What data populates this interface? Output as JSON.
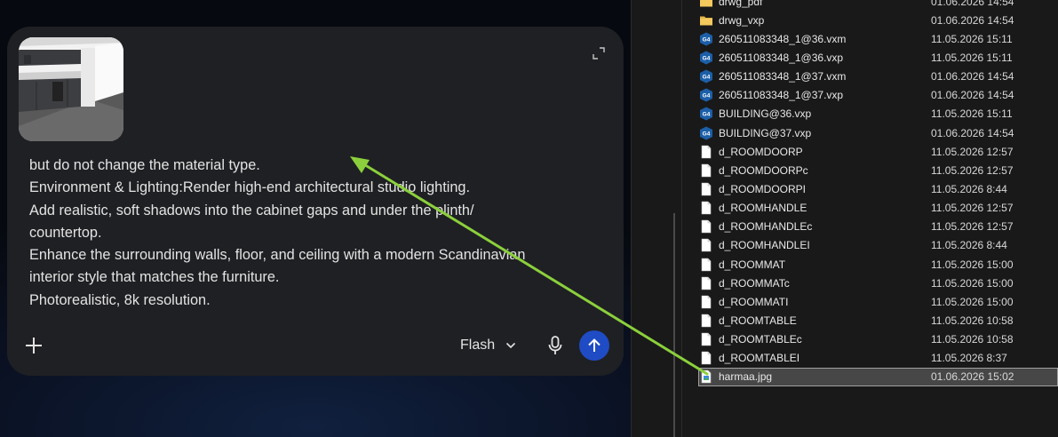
{
  "chat": {
    "prompt_lines": [
      "but do not change the material type.",
      "Environment & Lighting:Render high-end architectural studio lighting.",
      "Add realistic, soft shadows into the cabinet gaps and under the plinth/",
      "countertop.",
      "Enhance the surrounding walls, floor, and ceiling with a modern Scandinavian",
      "interior style that matches the furniture.",
      "Photorealistic, 8k resolution."
    ],
    "model_label": "Flash",
    "accent_color": "#1f4bc4"
  },
  "explorer": {
    "files": [
      {
        "name": "drwg_pdf",
        "date": "01.06.2026 14:54",
        "icon": "folder-icon"
      },
      {
        "name": "drwg_vxp",
        "date": "01.06.2026 14:54",
        "icon": "folder-icon"
      },
      {
        "name": "260511083348_1@36.vxm",
        "date": "11.05.2026 15:11",
        "icon": "g4-app-icon"
      },
      {
        "name": "260511083348_1@36.vxp",
        "date": "11.05.2026 15:11",
        "icon": "g4-app-icon"
      },
      {
        "name": "260511083348_1@37.vxm",
        "date": "01.06.2026 14:54",
        "icon": "g4-app-icon"
      },
      {
        "name": "260511083348_1@37.vxp",
        "date": "01.06.2026 14:54",
        "icon": "g4-app-icon"
      },
      {
        "name": "BUILDING@36.vxp",
        "date": "11.05.2026 15:11",
        "icon": "g4-app-icon"
      },
      {
        "name": "BUILDING@37.vxp",
        "date": "01.06.2026 14:54",
        "icon": "g4-app-icon"
      },
      {
        "name": "d_ROOMDOORP",
        "date": "11.05.2026 12:57",
        "icon": "file-icon"
      },
      {
        "name": "d_ROOMDOORPc",
        "date": "11.05.2026 12:57",
        "icon": "file-icon"
      },
      {
        "name": "d_ROOMDOORPI",
        "date": "11.05.2026 8:44",
        "icon": "file-icon"
      },
      {
        "name": "d_ROOMHANDLE",
        "date": "11.05.2026 12:57",
        "icon": "file-icon"
      },
      {
        "name": "d_ROOMHANDLEc",
        "date": "11.05.2026 12:57",
        "icon": "file-icon"
      },
      {
        "name": "d_ROOMHANDLEI",
        "date": "11.05.2026 8:44",
        "icon": "file-icon"
      },
      {
        "name": "d_ROOMMAT",
        "date": "11.05.2026 15:00",
        "icon": "file-icon"
      },
      {
        "name": "d_ROOMMATc",
        "date": "11.05.2026 15:00",
        "icon": "file-icon"
      },
      {
        "name": "d_ROOMMATI",
        "date": "11.05.2026 15:00",
        "icon": "file-icon"
      },
      {
        "name": "d_ROOMTABLE",
        "date": "11.05.2026 10:58",
        "icon": "file-icon"
      },
      {
        "name": "d_ROOMTABLEc",
        "date": "11.05.2026 10:58",
        "icon": "file-icon"
      },
      {
        "name": "d_ROOMTABLEI",
        "date": "11.05.2026 8:37",
        "icon": "file-icon"
      },
      {
        "name": "harmaa.jpg",
        "date": "01.06.2026 15:02",
        "icon": "image-file-icon",
        "selected": true
      }
    ],
    "app_icon_text": "G4"
  },
  "annotation_arrow_color": "#8bd03c"
}
